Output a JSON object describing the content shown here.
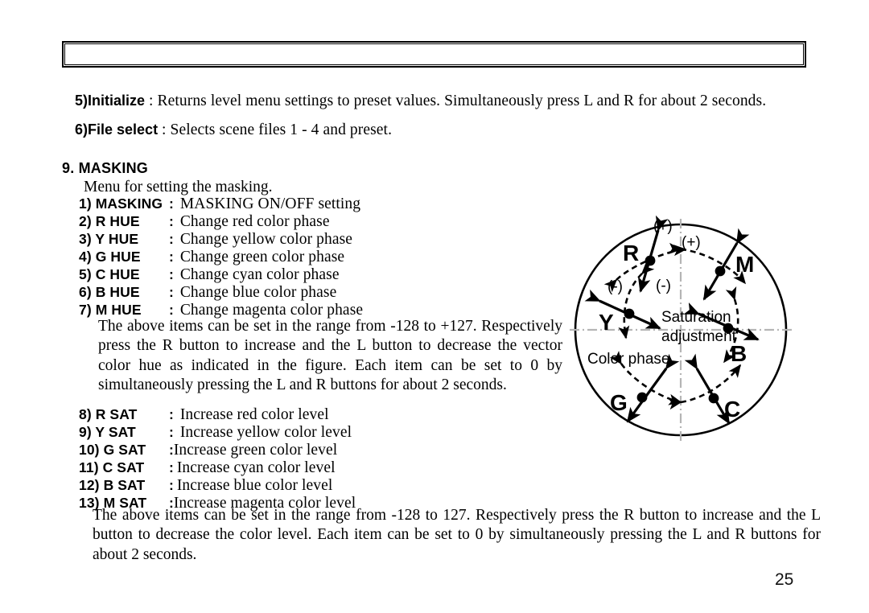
{
  "page": {
    "number": "25",
    "header_box_text": ""
  },
  "continued_items": [
    {
      "num": "5)",
      "label": "Initialize",
      "sep": " : ",
      "body": "Returns level menu settings to preset values.  Simultaneously press L and R for about 2 seconds."
    },
    {
      "num": "6)",
      "label": "File select",
      "sep": " : ",
      "body": "Selects scene files 1 - 4 and preset."
    }
  ],
  "section": {
    "heading": "9. MASKING",
    "subheading": "Menu for setting the masking.",
    "items": [
      {
        "num": "1)",
        "key": "MASKING",
        "colon": ":",
        "desc": "MASKING ON/OFF setting"
      },
      {
        "num": "2)",
        "key": "R HUE",
        "colon": ":",
        "desc": "Change red color phase"
      },
      {
        "num": "3)",
        "key": "Y HUE",
        "colon": ":",
        "desc": "Change yellow color phase"
      },
      {
        "num": "4)",
        "key": "G HUE",
        "colon": ":",
        "desc": "Change green color phase"
      },
      {
        "num": "5)",
        "key": "C HUE",
        "colon": ":",
        "desc": "Change cyan color phase"
      },
      {
        "num": "6)",
        "key": "B HUE",
        "colon": ":",
        "desc": "Change blue color phase"
      },
      {
        "num": "7)",
        "key": "M HUE",
        "colon": ":",
        "desc": "Change magenta color phase"
      }
    ],
    "hue_note": "The above items can be set in the range from -128 to +127. Respectively press the R button to increase and the L button to decrease the vector color hue as indicated in the figure.  Each item can be set to 0 by simultaneously pressing the L and R buttons for about 2 seconds.",
    "sat_items": [
      {
        "num": "8)",
        "key": "R SAT",
        "colon": ":",
        "desc": "Increase red color level"
      },
      {
        "num": "9)",
        "key": "Y SAT",
        "colon": ":",
        "desc": "Increase yellow color level"
      },
      {
        "num": "10)",
        "key": "G SAT",
        "colon": ":",
        "desc": "Increase green color level"
      },
      {
        "num": "11)",
        "key": "C SAT",
        "colon": ":",
        "desc": "Increase cyan color level"
      },
      {
        "num": "12)",
        "key": "B SAT",
        "colon": ":",
        "desc": "Increase blue color level"
      },
      {
        "num": "13)",
        "key": "M SAT",
        "colon": ":",
        "desc": "Increase magenta color level"
      }
    ],
    "sat_note": "The above items can be set in the range from -128 to 127.  Respectively press the R button to increase and the L button to decrease the color level.  Each item can be set to 0 by simultaneously pressing the L and R buttons for about 2 seconds."
  },
  "diagram": {
    "caption_saturation_line1": "Saturation",
    "caption_saturation_line2": "adjustment",
    "caption_color_phase": "Color phase",
    "node_labels": {
      "R": "R",
      "M": "M",
      "Y": "Y",
      "B": "B",
      "G": "G",
      "C": "C"
    },
    "sign_labels": {
      "sat_plus": "(+)",
      "sat_minus": "(-)",
      "phase_plus": "(+)",
      "phase_minus": "(-)"
    },
    "colors": {
      "stroke": "#000000",
      "axis": "#b5b5b5",
      "background": "#ffffff"
    }
  }
}
